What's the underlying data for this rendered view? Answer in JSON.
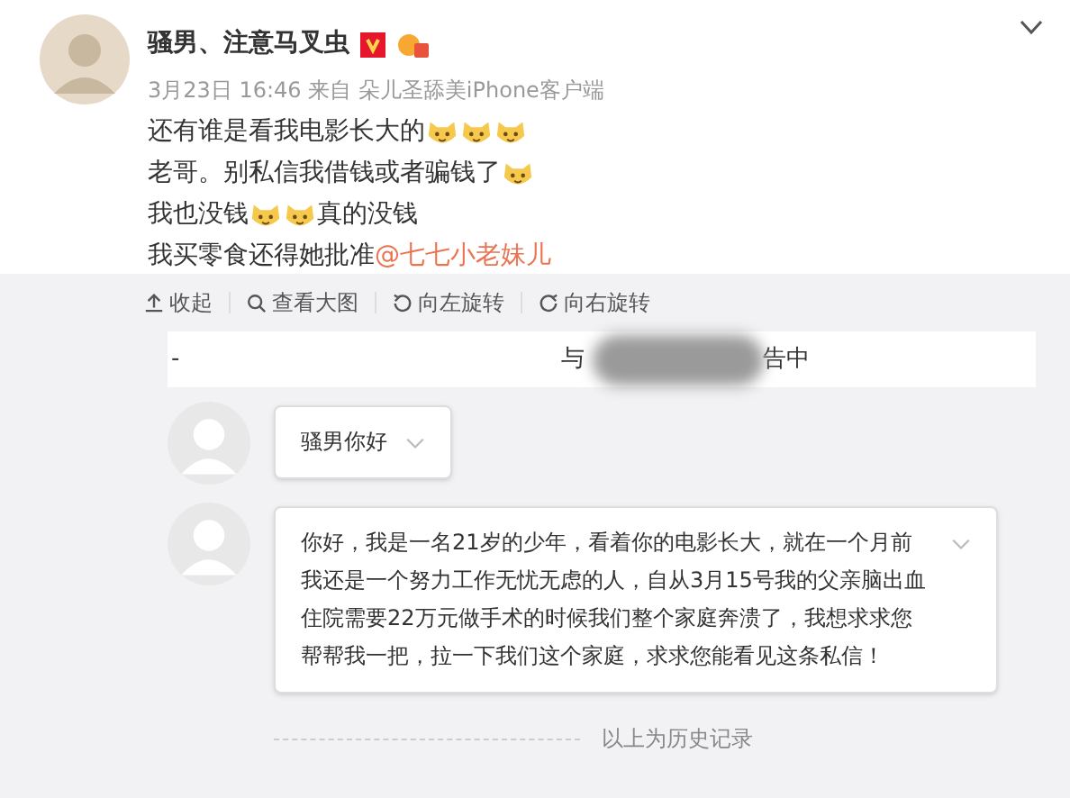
{
  "post": {
    "author": "骚男、注意马叉虫",
    "meta": "3月23日 16:46 来自 朵儿圣舔美iPhone客户端",
    "lines": [
      [
        {
          "kind": "text",
          "text": "还有谁是看我电影长大的"
        },
        {
          "kind": "emoji"
        },
        {
          "kind": "emoji"
        },
        {
          "kind": "emoji"
        }
      ],
      [
        {
          "kind": "text",
          "text": "老哥。别私信我借钱或者骗钱了"
        },
        {
          "kind": "emoji"
        }
      ],
      [
        {
          "kind": "text",
          "text": "我也没钱"
        },
        {
          "kind": "emoji"
        },
        {
          "kind": "emoji"
        },
        {
          "kind": "text",
          "text": "真的没钱"
        }
      ],
      [
        {
          "kind": "text",
          "text": "我买零食还得她批准"
        },
        {
          "kind": "mention",
          "text": "@七七小老妹儿"
        }
      ]
    ]
  },
  "toolbar": [
    "收起",
    "查看大图",
    "向左旋转",
    "向右旋转"
  ],
  "chat": {
    "header": [
      "-",
      "与",
      "告中"
    ],
    "messages": [
      {
        "text": "骚男你好"
      },
      {
        "text": "你好，我是一名21岁的少年，看着你的电影长大，就在一个月前我还是一个努力工作无忧无虑的人，自从3月15号我的父亲脑出血住院需要22万元做手术的时候我们整个家庭奔溃了，我想求求您帮帮我一把，拉一下我们这个家庭，求求您能看见这条私信！"
      }
    ],
    "footer": "以上为历史记录"
  }
}
